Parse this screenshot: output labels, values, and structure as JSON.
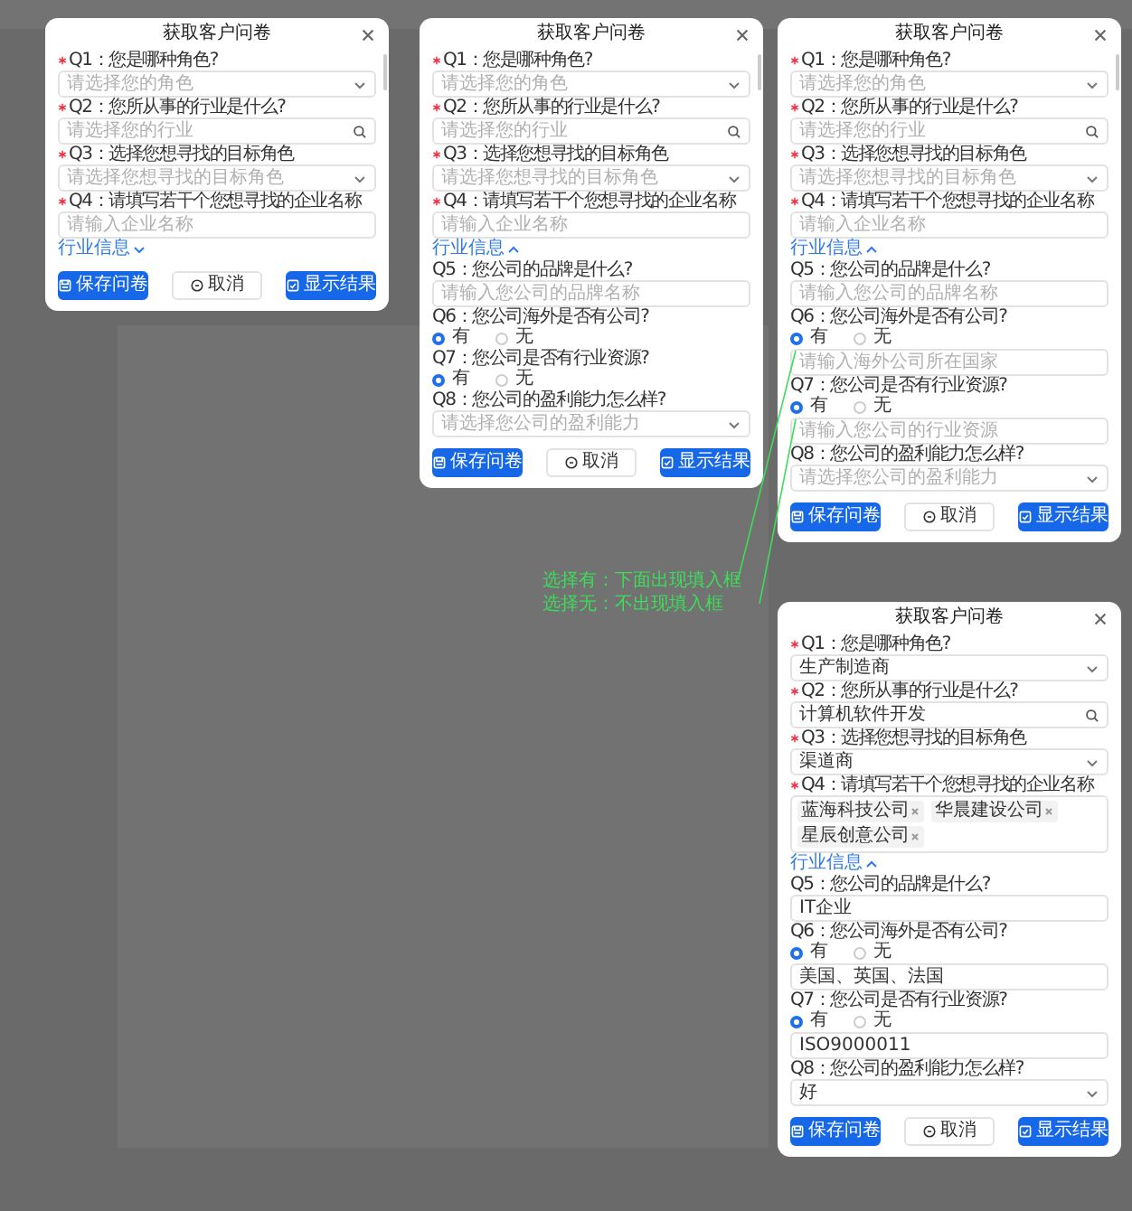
{
  "dialogs": [
    {
      "title": "获取客户问卷",
      "items": [
        {
          "kind": "select",
          "label": "Q1：您是哪种角色?",
          "required": true,
          "placeholder": "请选择您的角色"
        },
        {
          "kind": "search",
          "label": "Q2：您所从事的行业是什么?",
          "required": true,
          "placeholder": "请选择您的行业"
        },
        {
          "kind": "select",
          "label": "Q3：选择您想寻找的目标角色",
          "required": true,
          "placeholder": "请选择您想寻找的目标角色"
        },
        {
          "kind": "text",
          "label": "Q4：请填写若干个您想寻找的企业名称",
          "required": true,
          "placeholder": "请输入企业名称"
        },
        {
          "kind": "toggle",
          "label": "行业信息",
          "expanded": false
        }
      ],
      "buttons": [
        {
          "kind": "save",
          "label": "保存问卷",
          "primary": true
        },
        {
          "kind": "cancel",
          "label": "取消",
          "primary": false
        },
        {
          "kind": "result",
          "label": "显示结果",
          "primary": true
        }
      ]
    },
    {
      "title": "获取客户问卷",
      "items": [
        {
          "kind": "select",
          "label": "Q1：您是哪种角色?",
          "required": true,
          "placeholder": "请选择您的角色"
        },
        {
          "kind": "search",
          "label": "Q2：您所从事的行业是什么?",
          "required": true,
          "placeholder": "请选择您的行业"
        },
        {
          "kind": "select",
          "label": "Q3：选择您想寻找的目标角色",
          "required": true,
          "placeholder": "请选择您想寻找的目标角色"
        },
        {
          "kind": "text",
          "label": "Q4：请填写若干个您想寻找的企业名称",
          "required": true,
          "placeholder": "请输入企业名称"
        },
        {
          "kind": "toggle",
          "label": "行业信息",
          "expanded": true
        },
        {
          "kind": "text",
          "label": "Q5：您公司的品牌是什么?",
          "required": false,
          "placeholder": "请输入您公司的品牌名称"
        },
        {
          "kind": "radio",
          "label": "Q6：您公司海外是否有公司?",
          "options": [
            {
              "label": "有",
              "selected": true
            },
            {
              "label": "无",
              "selected": false
            }
          ]
        },
        {
          "kind": "radio",
          "label": "Q7：您公司是否有行业资源?",
          "options": [
            {
              "label": "有",
              "selected": true
            },
            {
              "label": "无",
              "selected": false
            }
          ]
        },
        {
          "kind": "select",
          "label": "Q8：您公司的盈利能力怎么样?",
          "required": false,
          "placeholder": "请选择您公司的盈利能力"
        }
      ],
      "buttons": [
        {
          "kind": "save",
          "label": "保存问卷",
          "primary": true
        },
        {
          "kind": "cancel",
          "label": "取消",
          "primary": false
        },
        {
          "kind": "result",
          "label": "显示结果",
          "primary": true
        }
      ]
    },
    {
      "title": "获取客户问卷",
      "items": [
        {
          "kind": "select",
          "label": "Q1：您是哪种角色?",
          "required": true,
          "placeholder": "请选择您的角色"
        },
        {
          "kind": "search",
          "label": "Q2：您所从事的行业是什么?",
          "required": true,
          "placeholder": "请选择您的行业"
        },
        {
          "kind": "select",
          "label": "Q3：选择您想寻找的目标角色",
          "required": true,
          "placeholder": "请选择您想寻找的目标角色"
        },
        {
          "kind": "text",
          "label": "Q4：请填写若干个您想寻找的企业名称",
          "required": true,
          "placeholder": "请输入企业名称"
        },
        {
          "kind": "toggle",
          "label": "行业信息",
          "expanded": true
        },
        {
          "kind": "text",
          "label": "Q5：您公司的品牌是什么?",
          "required": false,
          "placeholder": "请输入您公司的品牌名称"
        },
        {
          "kind": "radio",
          "label": "Q6：您公司海外是否有公司?",
          "options": [
            {
              "label": "有",
              "selected": true
            },
            {
              "label": "无",
              "selected": false
            }
          ],
          "detail": {
            "placeholder": "请输入海外公司所在国家"
          }
        },
        {
          "kind": "radio",
          "label": "Q7：您公司是否有行业资源?",
          "options": [
            {
              "label": "有",
              "selected": true
            },
            {
              "label": "无",
              "selected": false
            }
          ],
          "detail": {
            "placeholder": "请输入您公司的行业资源"
          }
        },
        {
          "kind": "select",
          "label": "Q8：您公司的盈利能力怎么样?",
          "required": false,
          "placeholder": "请选择您公司的盈利能力"
        }
      ],
      "buttons": [
        {
          "kind": "save",
          "label": "保存问卷",
          "primary": true
        },
        {
          "kind": "cancel",
          "label": "取消",
          "primary": false
        },
        {
          "kind": "result",
          "label": "显示结果",
          "primary": true
        }
      ]
    },
    {
      "title": "获取客户问卷",
      "items": [
        {
          "kind": "select",
          "label": "Q1：您是哪种角色?",
          "required": true,
          "value": "生产制造商"
        },
        {
          "kind": "search",
          "label": "Q2：您所从事的行业是什么?",
          "required": true,
          "value": "计算机软件开发"
        },
        {
          "kind": "select",
          "label": "Q3：选择您想寻找的目标角色",
          "required": true,
          "value": "渠道商"
        },
        {
          "kind": "tags",
          "label": "Q4：请填写若干个您想寻找的企业名称",
          "required": true,
          "tags": [
            "蓝海科技公司",
            "华晨建设公司",
            "星辰创意公司"
          ]
        },
        {
          "kind": "toggle",
          "label": "行业信息",
          "expanded": true
        },
        {
          "kind": "text",
          "label": "Q5：您公司的品牌是什么?",
          "required": false,
          "value": "IT企业"
        },
        {
          "kind": "radio",
          "label": "Q6：您公司海外是否有公司?",
          "options": [
            {
              "label": "有",
              "selected": true
            },
            {
              "label": "无",
              "selected": false
            }
          ],
          "detail": {
            "value": "美国、英国、法国"
          }
        },
        {
          "kind": "radio",
          "label": "Q7：您公司是否有行业资源?",
          "options": [
            {
              "label": "有",
              "selected": true
            },
            {
              "label": "无",
              "selected": false
            }
          ],
          "detail": {
            "value": "ISO9000011"
          }
        },
        {
          "kind": "select",
          "label": "Q8：您公司的盈利能力怎么样?",
          "required": false,
          "value": "好"
        }
      ],
      "buttons": [
        {
          "kind": "save",
          "label": "保存问卷",
          "primary": true
        },
        {
          "kind": "cancel",
          "label": "取消",
          "primary": false
        },
        {
          "kind": "result",
          "label": "显示结果",
          "primary": true
        }
      ]
    }
  ],
  "annotation": {
    "lines": [
      "选择有：下面出现填入框",
      "选择无：不出现填入框"
    ]
  }
}
